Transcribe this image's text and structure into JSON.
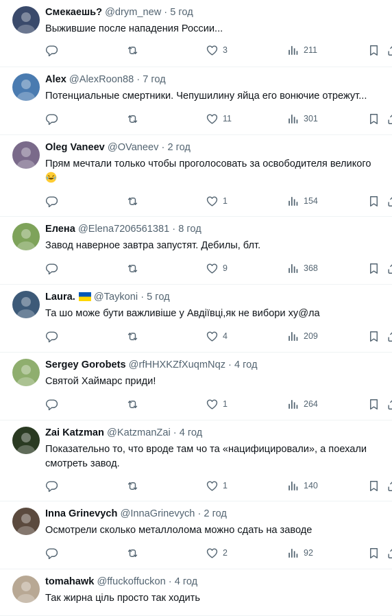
{
  "replies": [
    {
      "name": "Смекаешь?",
      "handle": "@drym_new",
      "time": "5 год",
      "text": "Выжившие после нападения России...",
      "likes": "3",
      "views": "211",
      "avatar_color": "#3a4a6b",
      "flag": false
    },
    {
      "name": "Alex",
      "handle": "@AlexRoon88",
      "time": "7 год",
      "text": "Потенциальные смертники. Чепушилину яйца его вонючие отрежут...",
      "likes": "11",
      "views": "301",
      "avatar_color": "#4a7bb0",
      "flag": false
    },
    {
      "name": "Oleg Vaneev",
      "handle": "@OVaneev",
      "time": "2 год",
      "text": "Прям мечтали только чтобы проголосовать за освободителя великого",
      "likes": "1",
      "views": "154",
      "avatar_color": "#7a6a8a",
      "flag": false,
      "emoji": "rofl-emoji"
    },
    {
      "name": "Елена",
      "handle": "@Elena7206561381",
      "time": "8 год",
      "text": "Завод наверное завтра запустят. Дебилы, блт.",
      "likes": "9",
      "views": "368",
      "avatar_color": "#7ea35a",
      "flag": false
    },
    {
      "name": "Laura.",
      "handle": "@Taykoni",
      "time": "5 год",
      "text": "Та шо може бути важливіше у Авдіївці,як не вибори ху@ла",
      "likes": "4",
      "views": "209",
      "avatar_color": "#3d5a78",
      "flag": true
    },
    {
      "name": "Sergey Gorobets",
      "handle": "@rfHHXKZfXuqmNqz",
      "time": "4 год",
      "text": "Святой Хаймарс приди!",
      "likes": "1",
      "views": "264",
      "avatar_color": "#8fae6e",
      "flag": false
    },
    {
      "name": "Zai Katzman",
      "handle": "@KatzmanZai",
      "time": "4 год",
      "text": "Показательно то, что вроде там чо та «нацифицировали», а поехали смотреть завод.",
      "likes": "1",
      "views": "140",
      "avatar_color": "#2a3a22",
      "flag": false
    },
    {
      "name": "Inna Grinevych",
      "handle": "@InnaGrinevych",
      "time": "2 год",
      "text": "Осмотрели сколько металлолома можно сдать на заводе",
      "likes": "2",
      "views": "92",
      "avatar_color": "#5b4a3e",
      "flag": false
    },
    {
      "name": "tomahawk",
      "handle": "@ffuckoffuckon",
      "time": "4 год",
      "text": "Так жирна ціль просто так ходить",
      "likes": "",
      "views": "",
      "avatar_color": "#b8a894",
      "flag": false
    }
  ],
  "colors": {
    "text": "#0f1419",
    "secondary": "#536471",
    "divider": "#eff3f4",
    "flag_blue": "#0057b7",
    "flag_yellow": "#ffd700"
  },
  "icons": [
    "reply-icon",
    "retweet-icon",
    "like-icon",
    "views-icon",
    "bookmark-icon",
    "share-icon"
  ]
}
